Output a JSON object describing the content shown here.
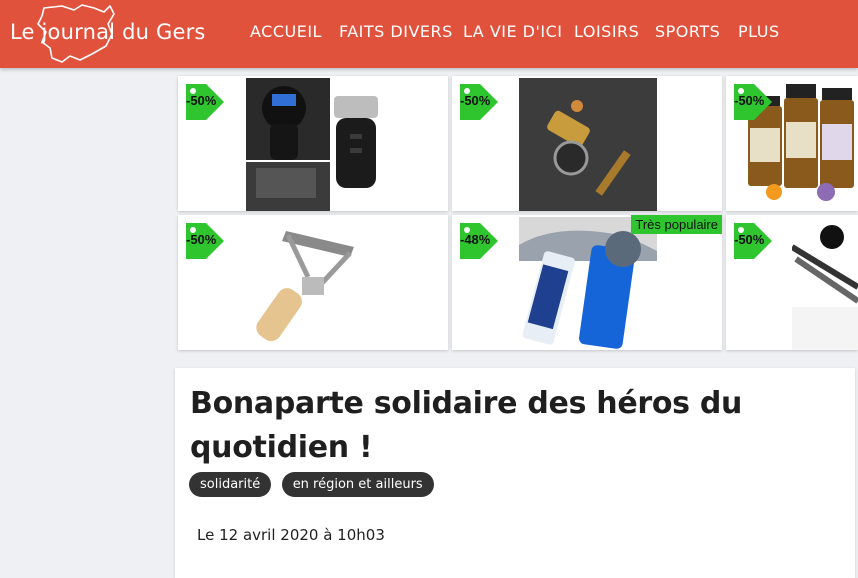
{
  "header": {
    "site_name": "Le journal du Gers",
    "nav": [
      {
        "label": "ACCUEIL"
      },
      {
        "label": "FAITS DIVERS"
      },
      {
        "label": "LA VIE D'ICI"
      },
      {
        "label": "LOISIRS"
      },
      {
        "label": "SPORTS"
      },
      {
        "label": "PLUS"
      }
    ]
  },
  "products": [
    {
      "discount": "-50%",
      "image": "car-charger-image"
    },
    {
      "discount": "-50%",
      "image": "brass-tool-image"
    },
    {
      "discount": "-50%",
      "image": "essential-oils-image"
    },
    {
      "discount": "-50%",
      "image": "lint-remover-image"
    },
    {
      "discount": "-48%",
      "image": "body-compound-image",
      "popular": "Très populaire"
    },
    {
      "discount": "-50%",
      "image": "nail-clipper-image"
    }
  ],
  "article": {
    "title": "Bonaparte solidaire des héros du quotidien !",
    "tags": [
      "solidarité",
      "en région et ailleurs"
    ],
    "date": "Le 12 avril 2020 à 10h03"
  },
  "colors": {
    "header_bg": "#e1523d",
    "badge_green": "#2ec52e",
    "tag_bg": "#333333"
  }
}
